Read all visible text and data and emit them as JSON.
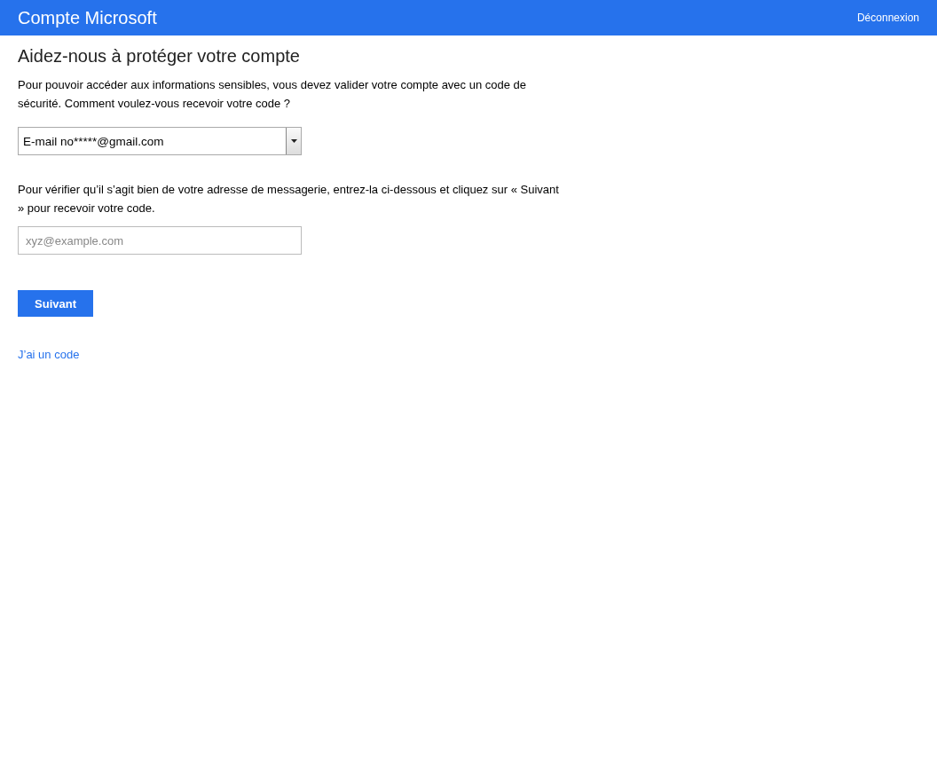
{
  "header": {
    "title": "Compte Microsoft",
    "signout_link": "Déconnexion"
  },
  "page": {
    "heading": "Aidez-nous à protéger votre compte",
    "intro": "Pour pouvoir accéder aux informations sensibles, vous devez valider votre compte avec un code de sécurité. Comment voulez-vous recevoir votre code ?",
    "method_dropdown": {
      "value": "E-mail no*****@gmail.com"
    },
    "instructions": "Pour vérifier qu’il s’agit bien de votre adresse de messagerie, entrez-la ci-dessous et cliquez sur « Suivant » pour recevoir votre code.",
    "email_field": {
      "placeholder": "xyz@example.com"
    },
    "next_button": "Suivant",
    "have_code_link": "J’ai un code"
  }
}
